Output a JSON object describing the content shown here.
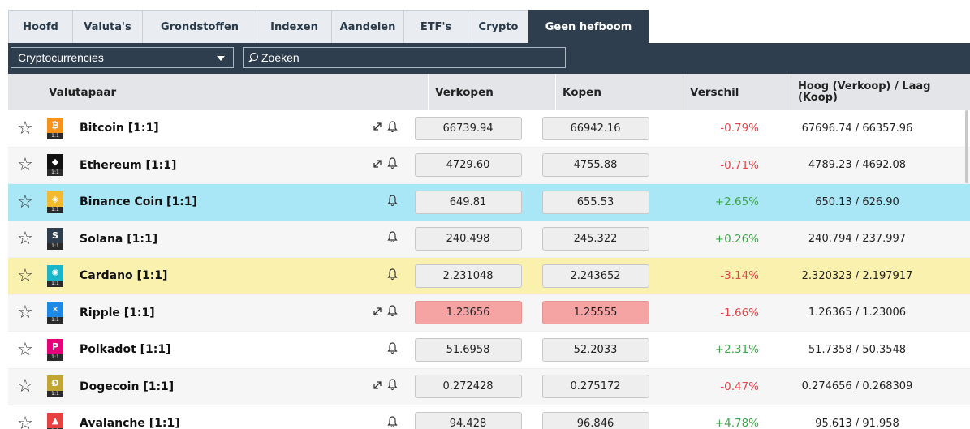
{
  "tabs": [
    {
      "label": "Hoofd",
      "active": false
    },
    {
      "label": "Valuta's",
      "active": false
    },
    {
      "label": "Grondstoffen",
      "active": false
    },
    {
      "label": "Indexen",
      "active": false
    },
    {
      "label": "Aandelen",
      "active": false
    },
    {
      "label": "ETF's",
      "active": false
    },
    {
      "label": "Crypto",
      "active": false
    },
    {
      "label": "Geen hefboom",
      "active": true
    }
  ],
  "toolbar": {
    "category_value": "Cryptocurrencies",
    "search_placeholder": "Zoeken"
  },
  "table": {
    "columns": {
      "pair": "Valutapaar",
      "sell": "Verkopen",
      "buy": "Kopen",
      "diff": "Verschil",
      "highlow": "Hoog (Verkoop) / Laag (Koop)"
    },
    "rows": [
      {
        "name": "Bitcoin [1:1]",
        "logo_symbol": "₿",
        "logo_color": "#f7931a",
        "icons": [
          "expand-icon",
          "bell-icon"
        ],
        "sell": "66739.94",
        "buy": "66942.16",
        "diff": "-0.79%",
        "diff_sign": "neg",
        "highlow": "67696.74 / 66357.96",
        "highlight": "none"
      },
      {
        "name": "Ethereum [1:1]",
        "logo_symbol": "◆",
        "logo_color": "#111111",
        "icons": [
          "expand-icon",
          "bell-icon"
        ],
        "sell": "4729.60",
        "buy": "4755.88",
        "diff": "-0.71%",
        "diff_sign": "neg",
        "highlow": "4789.23 / 4692.08",
        "highlight": "none"
      },
      {
        "name": "Binance Coin [1:1]",
        "logo_symbol": "◈",
        "logo_color": "#f3ba2f",
        "icons": [
          "bell-icon"
        ],
        "sell": "649.81",
        "buy": "655.53",
        "diff": "+2.65%",
        "diff_sign": "pos",
        "highlow": "650.13 / 626.90",
        "highlight": "blue"
      },
      {
        "name": "Solana [1:1]",
        "logo_symbol": "S",
        "logo_color": "#2f3e4e",
        "icons": [
          "bell-icon"
        ],
        "sell": "240.498",
        "buy": "245.322",
        "diff": "+0.26%",
        "diff_sign": "pos",
        "highlow": "240.794 / 237.997",
        "highlight": "none"
      },
      {
        "name": "Cardano [1:1]",
        "logo_symbol": "✺",
        "logo_color": "#19b5c9",
        "icons": [
          "bell-icon"
        ],
        "sell": "2.231048",
        "buy": "2.243652",
        "diff": "-3.14%",
        "diff_sign": "neg",
        "highlow": "2.320323 / 2.197917",
        "highlight": "yellow"
      },
      {
        "name": "Ripple [1:1]",
        "logo_symbol": "✕",
        "logo_color": "#1e88e5",
        "icons": [
          "expand-icon",
          "bell-icon"
        ],
        "sell": "1.23656",
        "buy": "1.25555",
        "diff": "-1.66%",
        "diff_sign": "neg",
        "highlow": "1.26365 / 1.23006",
        "highlight": "none",
        "price_highlight": "red"
      },
      {
        "name": "Polkadot [1:1]",
        "logo_symbol": "P",
        "logo_color": "#e6007a",
        "icons": [
          "bell-icon"
        ],
        "sell": "51.6958",
        "buy": "52.2033",
        "diff": "+2.31%",
        "diff_sign": "pos",
        "highlow": "51.7358 / 50.3548",
        "highlight": "none"
      },
      {
        "name": "Dogecoin [1:1]",
        "logo_symbol": "Ð",
        "logo_color": "#c2a633",
        "icons": [
          "expand-icon",
          "bell-icon"
        ],
        "sell": "0.272428",
        "buy": "0.275172",
        "diff": "-0.47%",
        "diff_sign": "neg",
        "highlow": "0.274656 / 0.268309",
        "highlight": "none"
      },
      {
        "name": "Avalanche [1:1]",
        "logo_symbol": "▲",
        "logo_color": "#e84142",
        "icons": [
          "bell-icon"
        ],
        "sell": "94.428",
        "buy": "96.846",
        "diff": "+4.78%",
        "diff_sign": "pos",
        "highlow": "95.613 / 91.958",
        "highlight": "none"
      }
    ]
  }
}
